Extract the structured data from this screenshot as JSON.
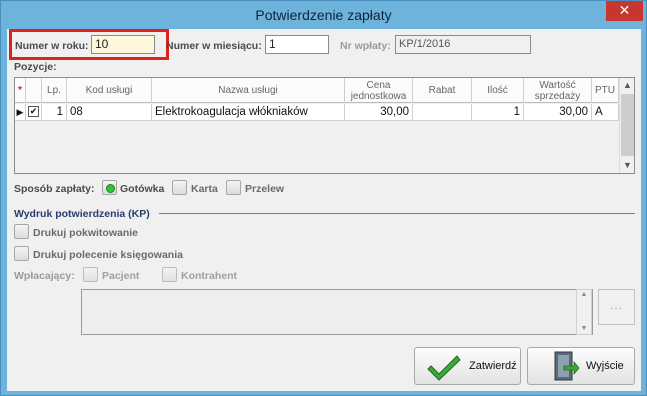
{
  "window": {
    "title": "Potwierdzenie zapłaty",
    "close_glyph": "✕"
  },
  "header": {
    "year_number_label": "Numer w roku:",
    "year_number_value": "10",
    "month_number_label": "Numer w miesiącu:",
    "month_number_value": "1",
    "payment_number_label": "Nr wpłaty:",
    "payment_number_value": "KP/1/2016"
  },
  "positions": {
    "label": "Pozycje:",
    "columns": {
      "star": "*",
      "lp": "Lp.",
      "code": "Kod usługi",
      "name": "Nazwa usługi",
      "unit_price": "Cena jednostkowa",
      "discount": "Rabat",
      "quantity": "Ilość",
      "sale_value": "Wartość sprzedaży",
      "ptu": "PTU"
    },
    "rows": [
      {
        "marker": "▶",
        "check": "✔",
        "lp": "1",
        "code": "08",
        "name": "Elektrokoagulacja włókniaków",
        "unit_price": "30,00",
        "discount": "",
        "quantity": "1",
        "sale_value": "30,00",
        "ptu": "A"
      }
    ]
  },
  "payment": {
    "label": "Sposób zapłaty:",
    "cash": "Gotówka",
    "card": "Karta",
    "transfer": "Przelew",
    "selected": "Gotówka"
  },
  "print": {
    "section_title": "Wydruk potwierdzenia (KP)",
    "print_receipt": "Drukuj pokwitowanie",
    "print_order": "Drukuj polecenie księgowania",
    "payer_label": "Wpłacający:",
    "payer_patient": "Pacjent",
    "payer_contractor": "Kontrahent",
    "dots": "..."
  },
  "buttons": {
    "confirm": "Zatwierdź",
    "exit": "Wyjście"
  },
  "colors": {
    "title_bar": "#6db3dc",
    "highlight_frame": "#e0201f",
    "active_input": "#fdf7dc"
  }
}
